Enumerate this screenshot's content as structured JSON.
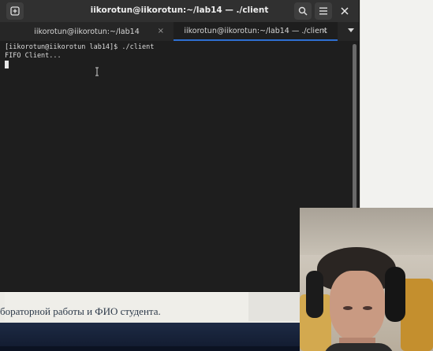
{
  "window": {
    "title": "iikorotun@iikorotun:~/lab14 — ./client"
  },
  "tabs": [
    {
      "label": "iikorotun@iikorotun:~/lab14",
      "active": false
    },
    {
      "label": "iikorotun@iikorotun:~/lab14 — ./client",
      "active": true
    }
  ],
  "terminal": {
    "lines": [
      "[iikorotun@iikorotun lab14]$ ./client",
      "FIFO Client..."
    ]
  },
  "background_document": {
    "visible_text": "бораторной работы и ФИО студента."
  },
  "icons": {
    "new_tab": "new-tab-icon",
    "search": "search-icon",
    "menu": "hamburger-menu-icon",
    "close": "close-icon",
    "dropdown": "chevron-down-icon"
  },
  "colors": {
    "titlebar": "#303030",
    "terminal_bg": "#1e1e1e",
    "active_tab_accent": "#2f6fd1"
  }
}
